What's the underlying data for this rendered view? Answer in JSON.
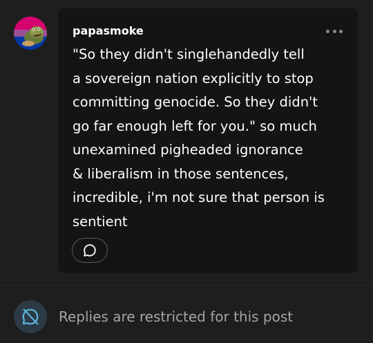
{
  "post": {
    "username": "papasmoke",
    "text": "\"So they didn't singlehandedly tell\na sovereign nation explicitly to stop\ncommitting genocide. So they didn't\ngo far enough left for you.\" so much\nunexamined pigheaded ignorance\n& liberalism in those sentences,\nincredible, i'm not sure that person is\nsentient",
    "avatar_colors": [
      "#d60270",
      "#9b4f96",
      "#0038a8"
    ],
    "more_icon": "ellipsis-icon",
    "reply_icon": "speech-bubble-icon"
  },
  "footer": {
    "restricted_text": "Replies are restricted for this post",
    "icon": "comment-disabled-icon",
    "icon_color": "#5ab1d6"
  }
}
